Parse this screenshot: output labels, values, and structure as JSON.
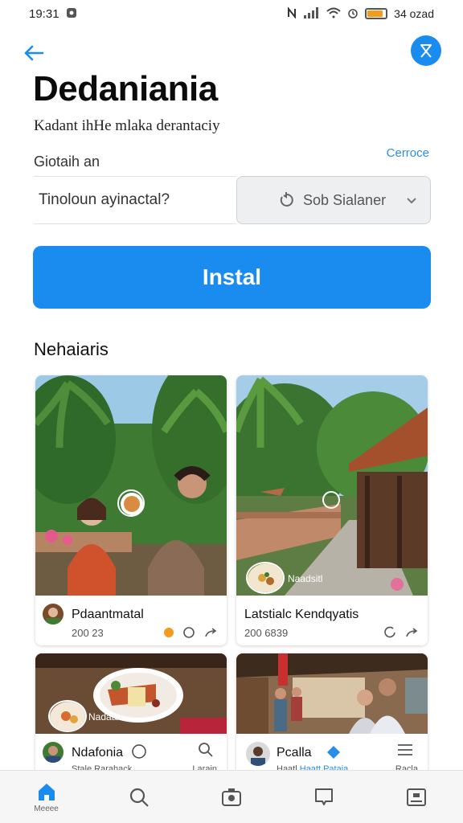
{
  "status": {
    "time": "19:31",
    "carrier": "34 ozad",
    "battery_level": 0.85
  },
  "header": {
    "title": "Dedaniania",
    "subtitle": "Kadant ihHe mlaka derantaciy"
  },
  "form": {
    "label": "Giotaih an",
    "link": "Cerroce",
    "input_value": "Tinoloun ayinactal?",
    "select_value": "Sob Sialaner",
    "button_label": "Instal"
  },
  "feed": {
    "heading": "Nehaiaris",
    "cards": [
      {
        "title": "Pdaantmatal",
        "meta": "200 23",
        "like_color": "#f29b1d"
      },
      {
        "title": "Latstialc Kendqyatis",
        "meta": "200 6839",
        "photo_label": "Naadsitl"
      },
      {
        "title": "Ndafonia",
        "meta": "Stale Rarahack",
        "action_label": "Larain",
        "photo_label": "Nadaal"
      },
      {
        "title": "Pcalla",
        "meta": "Haatl",
        "meta_link": "Haatt Pataia",
        "action_label": "Racla"
      }
    ]
  },
  "bottom_nav": {
    "home_label": "Meeee"
  },
  "colors": {
    "accent": "#1a8cf0",
    "status_battery": "#f29b1d"
  }
}
